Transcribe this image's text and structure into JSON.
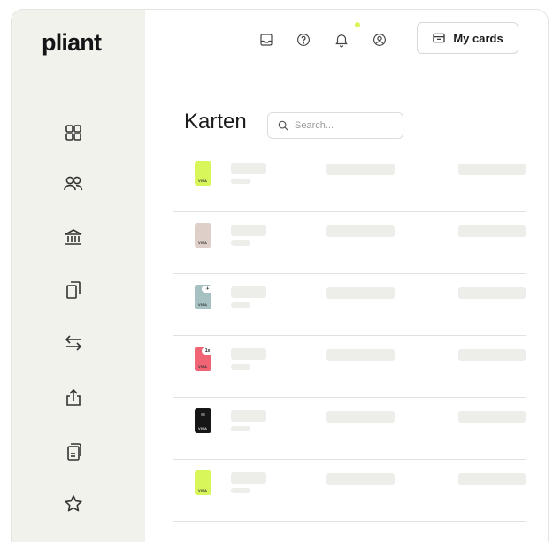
{
  "app": {
    "logo_text": "pliant"
  },
  "sidebar": {
    "items": [
      {
        "icon": "grid-icon",
        "id": "dashboard"
      },
      {
        "icon": "users-icon",
        "id": "team"
      },
      {
        "icon": "bank-icon",
        "id": "accounts"
      },
      {
        "icon": "cards-icon",
        "id": "cards"
      },
      {
        "icon": "transfer-icon",
        "id": "transactions"
      },
      {
        "icon": "export-icon",
        "id": "export"
      },
      {
        "icon": "document-icon",
        "id": "statements"
      },
      {
        "icon": "star-icon",
        "id": "rewards"
      }
    ]
  },
  "header": {
    "icons": [
      "inbox-icon",
      "help-icon",
      "bell-icon",
      "account-icon"
    ],
    "notification_dot_color": "#d8f55a",
    "my_cards_label": "My cards"
  },
  "main": {
    "title": "Karten",
    "search": {
      "placeholder": "Search...",
      "value": ""
    },
    "card_rows": [
      {
        "card_color": "#d8f55a",
        "brand": "VISA",
        "badge": "",
        "style": "lime"
      },
      {
        "card_color": "#ded0c8",
        "brand": "VISA",
        "badge": "",
        "style": "beige"
      },
      {
        "card_color": "#a7c1c2",
        "brand": "VISA",
        "badge": "✈",
        "style": "teal"
      },
      {
        "card_color": "#f16476",
        "brand": "VISA",
        "badge": "1x",
        "style": "pink"
      },
      {
        "card_color": "#161616",
        "brand": "VISA",
        "badge": "",
        "style": "dark"
      },
      {
        "card_color": "#d8f55a",
        "brand": "VISA",
        "badge": "",
        "style": "lime"
      }
    ]
  },
  "colors": {
    "sidebar_bg": "#f2f2ed",
    "skeleton": "#ededea",
    "divider": "#e1e1dd"
  }
}
